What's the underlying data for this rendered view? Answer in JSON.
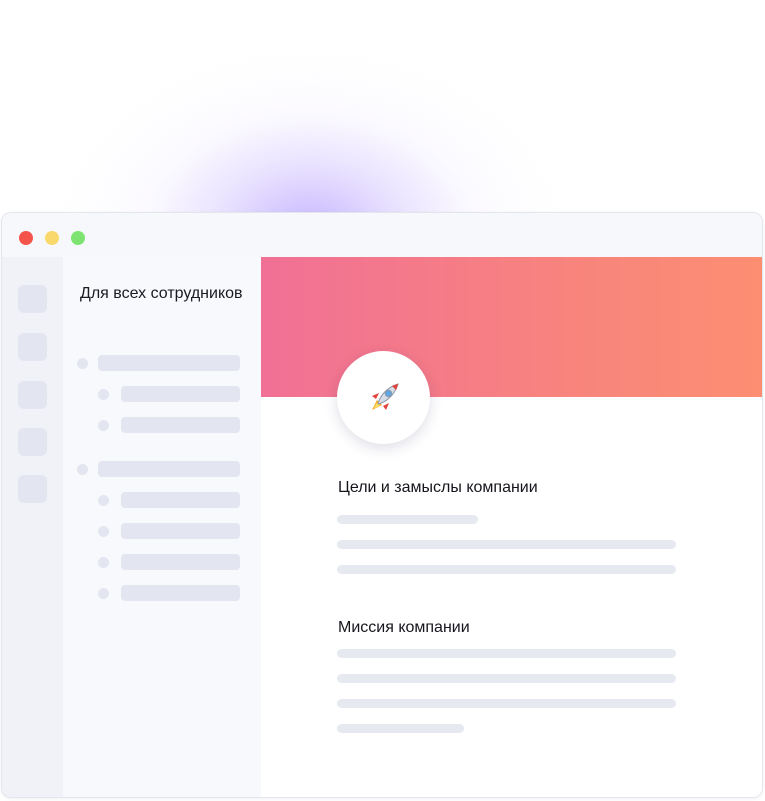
{
  "window": {
    "controls": [
      "close",
      "minimize",
      "maximize"
    ],
    "colors": {
      "close": "#f4544a",
      "minimize": "#f9d86c",
      "maximize": "#7ee471"
    }
  },
  "rail": {
    "items": [
      "placeholder",
      "placeholder",
      "placeholder",
      "placeholder",
      "placeholder"
    ]
  },
  "sidebar": {
    "title": "Для всех сотрудников",
    "groups": [
      {
        "children": 2
      },
      {
        "children": 4
      }
    ]
  },
  "page": {
    "banner_gradient": [
      "#f17096",
      "#fd8e72"
    ],
    "icon": "rocket-icon",
    "sections": [
      {
        "heading": "Цели и замыслы компании"
      },
      {
        "heading": "Миссия компании"
      }
    ]
  }
}
